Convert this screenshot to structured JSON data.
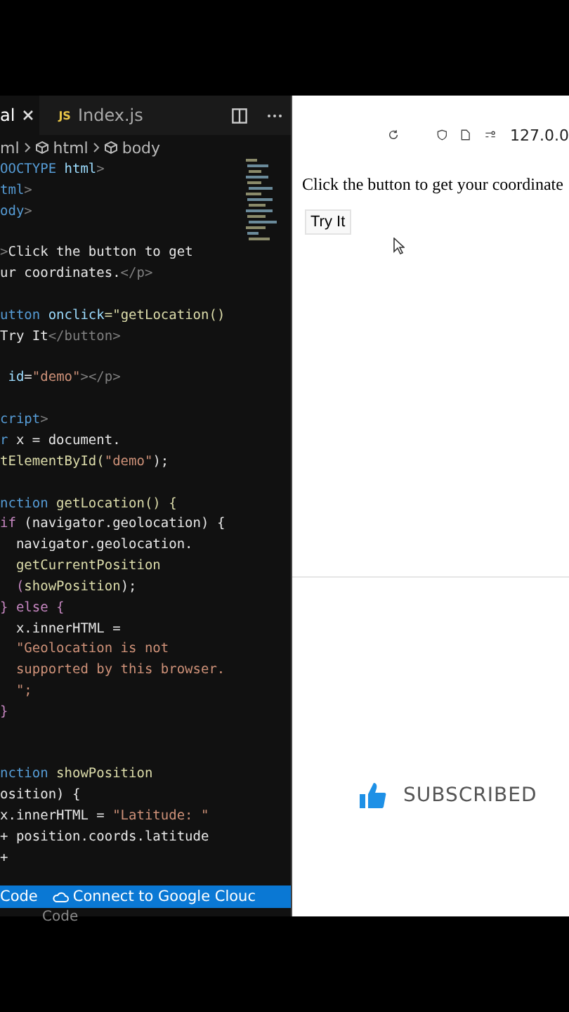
{
  "editor": {
    "tabs": [
      {
        "label": "al",
        "selected": true,
        "closable": true
      },
      {
        "label": "Index.js",
        "selected": false,
        "closable": false,
        "badge": "JS"
      }
    ],
    "breadcrumb": [
      "ml",
      "html",
      "body"
    ],
    "lines": [
      {
        "kind": "code",
        "tokens": [
          {
            "t": "OOCTYPE ",
            "kind": "tag"
          },
          {
            "t": "html",
            "kind": "attr"
          },
          {
            "t": ">",
            "kind": "punct"
          }
        ]
      },
      {
        "kind": "code",
        "tokens": [
          {
            "t": "tml",
            "kind": "tag"
          },
          {
            "t": ">",
            "kind": "punct"
          }
        ]
      },
      {
        "kind": "code",
        "tokens": [
          {
            "t": "ody",
            "kind": "tag"
          },
          {
            "t": ">",
            "kind": "punct"
          }
        ]
      },
      {
        "kind": "blank"
      },
      {
        "kind": "code",
        "tokens": [
          {
            "t": ">",
            "kind": "punct"
          },
          {
            "t": "Click the button to get",
            "kind": "plain"
          }
        ]
      },
      {
        "kind": "code",
        "tokens": [
          {
            "t": "ur coordinates.",
            "kind": "plain"
          },
          {
            "t": "</p>",
            "kind": "punct"
          }
        ]
      },
      {
        "kind": "blank"
      },
      {
        "kind": "code",
        "tokens": [
          {
            "t": "utton ",
            "kind": "tag"
          },
          {
            "t": "onclick",
            "kind": "attr"
          },
          {
            "t": "=\"getLocation()",
            "kind": "fn"
          }
        ]
      },
      {
        "kind": "code",
        "tokens": [
          {
            "t": "Try It",
            "kind": "plain"
          },
          {
            "t": "</button>",
            "kind": "punct"
          }
        ]
      },
      {
        "kind": "blank"
      },
      {
        "kind": "code",
        "tokens": [
          {
            "t": " id",
            "kind": "attr"
          },
          {
            "t": "=",
            "kind": "plain"
          },
          {
            "t": "\"demo\"",
            "kind": "str"
          },
          {
            "t": "></p>",
            "kind": "punct"
          }
        ]
      },
      {
        "kind": "blank"
      },
      {
        "kind": "code",
        "tokens": [
          {
            "t": "cript",
            "kind": "tag"
          },
          {
            "t": ">",
            "kind": "punct"
          }
        ]
      },
      {
        "kind": "code",
        "tokens": [
          {
            "t": "r ",
            "kind": "tag"
          },
          {
            "t": "x = document.",
            "kind": "plain"
          }
        ]
      },
      {
        "kind": "code",
        "tokens": [
          {
            "t": "tElementById(",
            "kind": "fn"
          },
          {
            "t": "\"demo\"",
            "kind": "str"
          },
          {
            "t": ");",
            "kind": "plain"
          }
        ]
      },
      {
        "kind": "blank"
      },
      {
        "kind": "code",
        "tokens": [
          {
            "t": "nction ",
            "kind": "tag"
          },
          {
            "t": "getLocation() {",
            "kind": "fn"
          }
        ]
      },
      {
        "kind": "code",
        "tokens": [
          {
            "t": "if ",
            "kind": "kw"
          },
          {
            "t": "(navigator.geolocation) {",
            "kind": "plain"
          }
        ]
      },
      {
        "kind": "code",
        "tokens": [
          {
            "t": "  navigator.geolocation.",
            "kind": "plain"
          }
        ]
      },
      {
        "kind": "code",
        "tokens": [
          {
            "t": "  getCurrentPosition",
            "kind": "fn"
          }
        ]
      },
      {
        "kind": "code",
        "tokens": [
          {
            "t": "  (",
            "kind": "kw"
          },
          {
            "t": "showPosition",
            "kind": "fn"
          },
          {
            "t": ");",
            "kind": "plain"
          }
        ]
      },
      {
        "kind": "code",
        "tokens": [
          {
            "t": "} else {",
            "kind": "kw"
          }
        ]
      },
      {
        "kind": "code",
        "tokens": [
          {
            "t": "  x.innerHTML =",
            "kind": "plain"
          }
        ]
      },
      {
        "kind": "code",
        "tokens": [
          {
            "t": "  \"Geolocation is not",
            "kind": "str"
          }
        ]
      },
      {
        "kind": "code",
        "tokens": [
          {
            "t": "  supported by this browser.",
            "kind": "str"
          }
        ]
      },
      {
        "kind": "code",
        "tokens": [
          {
            "t": "  \";",
            "kind": "str"
          }
        ]
      },
      {
        "kind": "code",
        "tokens": [
          {
            "t": "}",
            "kind": "kw"
          }
        ]
      },
      {
        "kind": "blank"
      },
      {
        "kind": "blank"
      },
      {
        "kind": "code",
        "tokens": [
          {
            "t": "nction ",
            "kind": "tag"
          },
          {
            "t": "showPosition",
            "kind": "fn"
          }
        ]
      },
      {
        "kind": "code",
        "tokens": [
          {
            "t": "osition) {",
            "kind": "plain"
          }
        ]
      },
      {
        "kind": "code",
        "tokens": [
          {
            "t": "x.innerHTML = ",
            "kind": "plain"
          },
          {
            "t": "\"Latitude: \"",
            "kind": "str"
          }
        ]
      },
      {
        "kind": "code",
        "tokens": [
          {
            "t": "+ position.coords.latitude",
            "kind": "plain"
          }
        ]
      },
      {
        "kind": "code",
        "tokens": [
          {
            "t": "+",
            "kind": "plain"
          }
        ]
      }
    ],
    "status_bar": {
      "items": [
        "Code",
        "Connect to Google Clouc"
      ],
      "below": "Code"
    }
  },
  "browser": {
    "address": "127.0.0",
    "text": "Click the button to get your coordinate",
    "button": "Try It"
  },
  "overlay": {
    "label": "SUBSCRIBED"
  }
}
